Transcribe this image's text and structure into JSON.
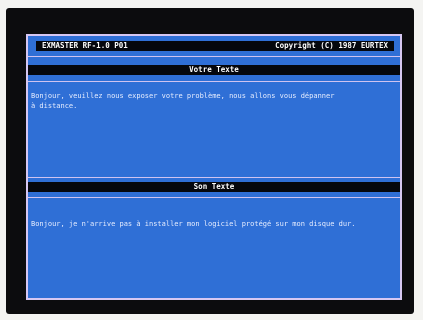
{
  "header": {
    "left": "EXMASTER RF-1.0 P01",
    "right": "Copyright (C) 1987 EURTEX"
  },
  "panes": {
    "user": {
      "title": "Votre Texte",
      "text": "Bonjour, veuillez nous exposer votre problème, nous allons vous dépanner\nà distance."
    },
    "system": {
      "title": "Son Texte",
      "text": "Bonjour, je n'arrive pas à installer mon logiciel protégé sur mon disque dur."
    }
  },
  "colors": {
    "screen_background": "#2f6fd6",
    "bar_background": "#05070d",
    "divider": "#cfc3f0"
  }
}
